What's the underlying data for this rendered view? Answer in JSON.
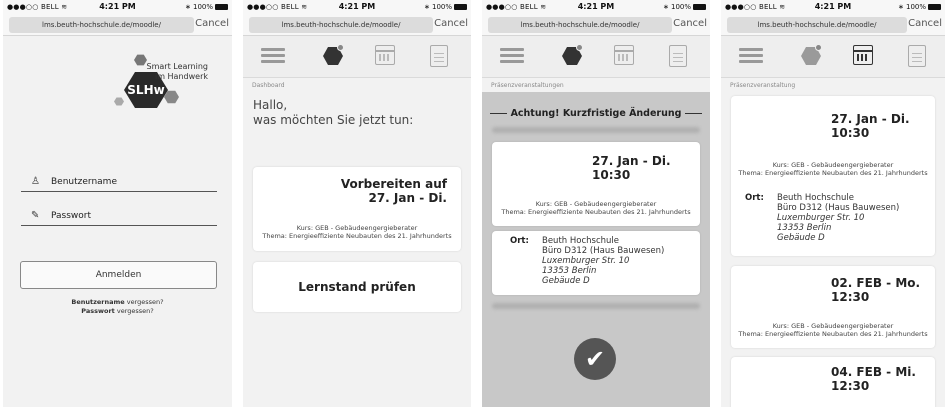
{
  "status": {
    "carrier": "●●●○○ BELL ",
    "wifi": "≋",
    "time": "4:21 PM",
    "bluetooth": "∗",
    "battery": "100%"
  },
  "browser": {
    "url": "lms.beuth-hochschule.de/moodle/",
    "cancel": "Cancel"
  },
  "login": {
    "logo_text": "SLHw",
    "tagline1": "Smart Learning",
    "tagline2": "im Handwerk",
    "username_placeholder": "Benutzername",
    "password_placeholder": "Passwort",
    "login_button": "Anmelden",
    "forgot_user_bold": "Benutzername",
    "forgot_user_rest": " vergessen?",
    "forgot_pass_bold": "Passwort",
    "forgot_pass_rest": " vergessen?"
  },
  "dashboard": {
    "breadcrumb": "Dashboard",
    "greeting1": "Hallo,",
    "greeting2": "was möchten Sie jetzt tun:",
    "card1_title1": "Vorbereiten auf",
    "card1_title2": "27. Jan - Di.",
    "course": "Kurs: GEB - Gebäudeengergieberater",
    "topic": "Thema: Energieeffiziente Neubauten des 21. Jahrhunderts",
    "card2_title": "Lernstand prüfen"
  },
  "alert": {
    "breadcrumb": "Präsenzveranstaltungen",
    "warning": "Achtung! Kurzfristige Änderung",
    "date": "27. Jan - Di.",
    "time": "10:30",
    "course": "Kurs: GEB - Gebäudeengergieberater",
    "topic": "Thema: Energieeffiziente Neubauten des 21. Jahrhunderts",
    "location_label": "Ort:",
    "loc1": "Beuth Hochschule",
    "loc2": "Büro D312 (Haus Bauwesen)",
    "loc3": "Luxemburger Str. 10",
    "loc4": "13353 Berlin",
    "loc5": "Gebäude D"
  },
  "events": {
    "breadcrumb": "Präsenzveranstaltung",
    "items": [
      {
        "date": "27. Jan - Di.",
        "time": "10:30"
      },
      {
        "date": "02. FEB - Mo.",
        "time": "12:30"
      },
      {
        "date": "04. FEB - Mi.",
        "time": "12:30"
      }
    ],
    "course": "Kurs: GEB - Gebäudeengergieberater",
    "topic": "Thema: Energieeffiziente Neubauten des 21. Jahrhunderts",
    "location_label": "Ort:",
    "loc1": "Beuth Hochschule",
    "loc2": "Büro D312 (Haus Bauwesen)",
    "loc3": "Luxemburger Str. 10",
    "loc4": "13353 Berlin",
    "loc5": "Gebäude D"
  }
}
